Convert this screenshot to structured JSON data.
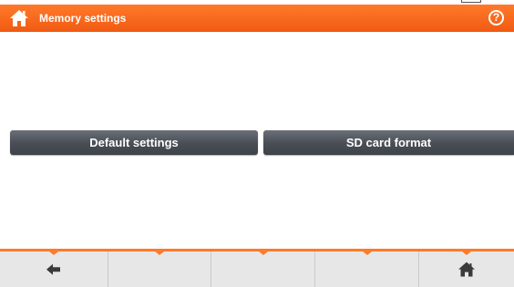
{
  "header": {
    "title": "Memory settings",
    "accent_color": "#f26a1b",
    "home_icon": "home-icon",
    "help_icon": "help-icon",
    "help_glyph": "?"
  },
  "main": {
    "default_settings_label": "Default settings",
    "sd_card_format_label": "SD card format"
  },
  "footer": {
    "keys": [
      {
        "icon": "back-arrow-icon"
      },
      {
        "icon": ""
      },
      {
        "icon": ""
      },
      {
        "icon": ""
      },
      {
        "icon": "home-icon"
      }
    ]
  }
}
